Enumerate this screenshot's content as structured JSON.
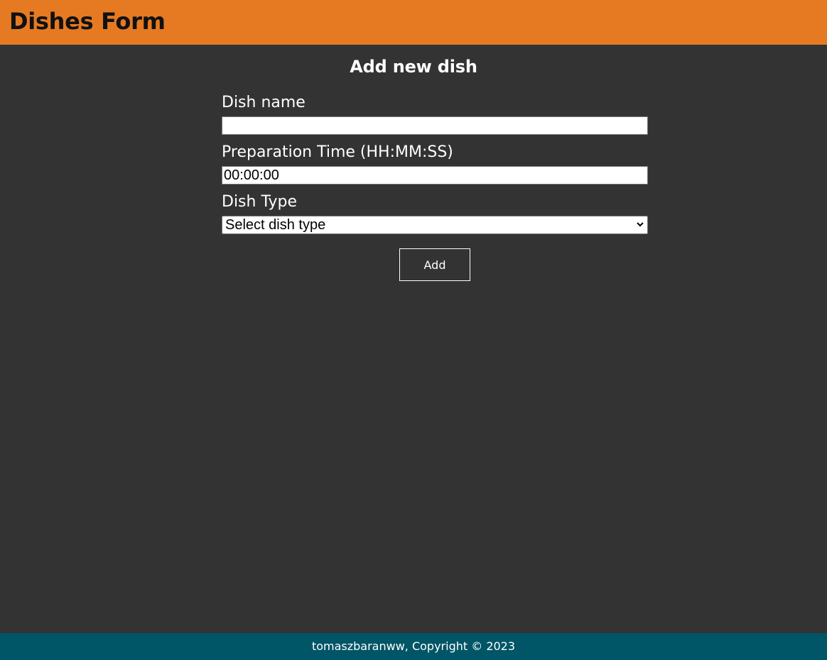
{
  "header": {
    "title": "Dishes Form"
  },
  "form": {
    "title": "Add new dish",
    "dish_name": {
      "label": "Dish name",
      "value": ""
    },
    "preparation_time": {
      "label": "Preparation Time (HH:MM:SS)",
      "value": "00:00:00"
    },
    "dish_type": {
      "label": "Dish Type",
      "selected": "Select dish type"
    },
    "submit_label": "Add"
  },
  "footer": {
    "text": "tomaszbaranww, Copyright © 2023"
  },
  "colors": {
    "header_bg": "#e67a22",
    "page_bg": "#333333",
    "footer_bg": "#005566",
    "text": "#ffffff",
    "title_text": "#111111"
  },
  "icons": {
    "select_arrow": "chevron-down-icon"
  }
}
